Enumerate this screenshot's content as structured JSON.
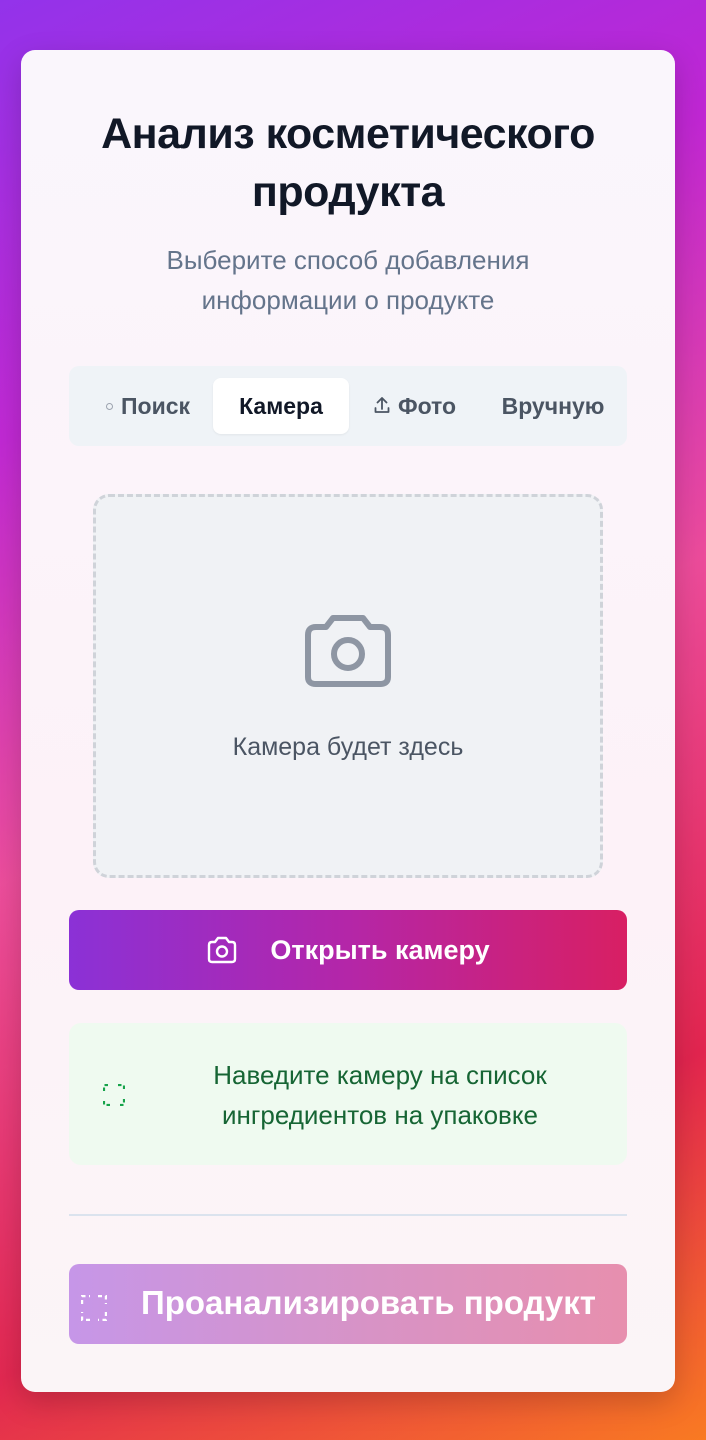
{
  "header": {
    "title": "Анализ косметического продукта",
    "subtitle": "Выберите способ добавления информации о продукте"
  },
  "tabs": [
    {
      "label": "Поиск",
      "icon": "dot-icon",
      "active": false
    },
    {
      "label": "Камера",
      "icon": null,
      "active": true
    },
    {
      "label": "Фото",
      "icon": "upload-icon",
      "active": false
    },
    {
      "label": "Вручную",
      "icon": null,
      "active": false
    }
  ],
  "camera": {
    "placeholder": "Камера будет здесь",
    "open_button_label": "Открыть камеру",
    "icon": "camera-icon"
  },
  "hint": {
    "text": "Наведите камеру на список ингредиентов на упаковке",
    "icon": "scan-icon"
  },
  "analyze": {
    "label": "Проанализировать продукт",
    "icon": "scan-icon",
    "enabled": false
  },
  "colors": {
    "primary_start": "#8b31d6",
    "primary_end": "#d81f63",
    "hint_bg": "#effaf0",
    "hint_text": "#166534"
  }
}
